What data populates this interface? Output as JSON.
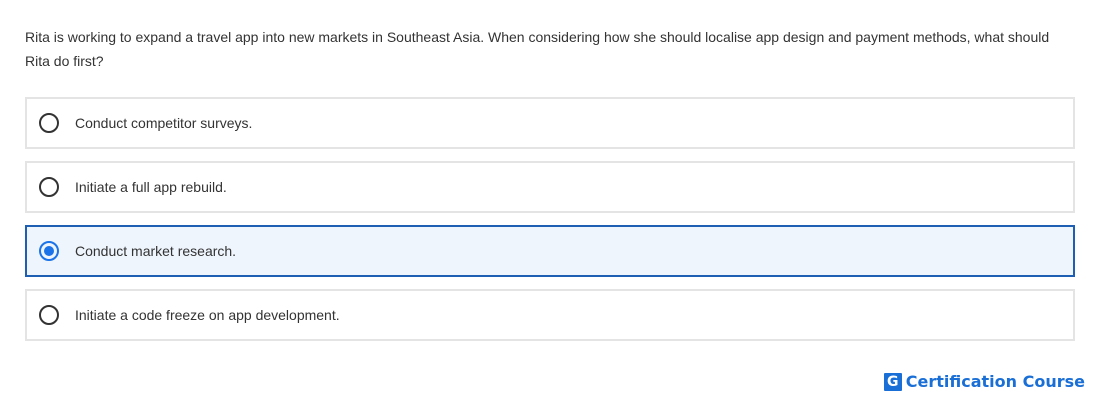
{
  "question": {
    "text": "Rita is working to expand a travel app into new markets in Southeast Asia. When considering how she should localise app design and payment methods, what should Rita do first?"
  },
  "options": [
    {
      "label": "Conduct competitor surveys.",
      "selected": false
    },
    {
      "label": "Initiate a full app rebuild.",
      "selected": false
    },
    {
      "label": "Conduct market research.",
      "selected": true
    },
    {
      "label": "Initiate a code freeze on app development.",
      "selected": false
    }
  ],
  "brand": {
    "icon_letter": "G",
    "name": "Certification Course",
    "color": "#1a6fd6"
  },
  "colors": {
    "selected_border": "#1e5fb4",
    "selected_background": "#eef5fd",
    "radio_selected": "#1a73e8",
    "option_border": "#e4e4e4"
  }
}
